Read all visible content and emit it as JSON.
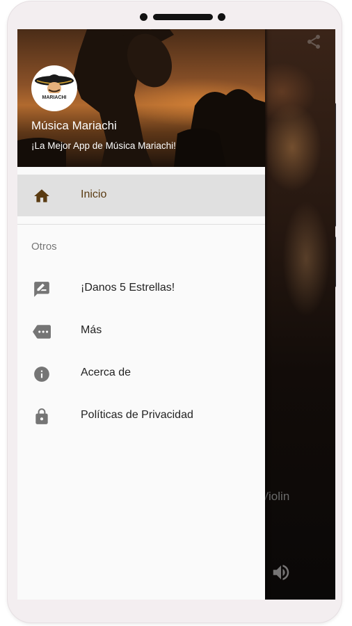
{
  "header": {
    "logo_text": "MARIACHI",
    "title": "Música Mariachi",
    "subtitle": "¡La Mejor App de Música Mariachi!"
  },
  "menu": {
    "main_items": [
      {
        "label": "Inicio",
        "icon": "home-icon",
        "active": true
      }
    ],
    "section_title": "Otros",
    "other_items": [
      {
        "label": "¡Danos 5 Estrellas!",
        "icon": "rate-review-icon"
      },
      {
        "label": "Más",
        "icon": "more-tag-icon"
      },
      {
        "label": "Acerca de",
        "icon": "info-icon"
      },
      {
        "label": "Políticas de Privacidad",
        "icon": "lock-icon"
      }
    ]
  },
  "background": {
    "partial_label": "Violin",
    "icons": [
      "share-icon",
      "volume-icon"
    ]
  },
  "colors": {
    "active_icon": "#5a3b12",
    "icon_gray": "#757575",
    "active_bg": "#e0e0e0"
  }
}
